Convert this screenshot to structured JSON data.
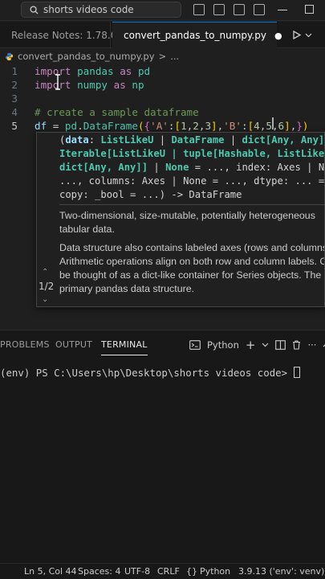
{
  "titlebar": {
    "search_text": "shorts videos code"
  },
  "tabs": [
    {
      "label": "Release Notes: 1.78.0",
      "active": false
    },
    {
      "label": "convert_pandas_to_numpy.py",
      "active": true,
      "modified_indicator": "●"
    }
  ],
  "breadcrumb": {
    "file": "convert_pandas_to_numpy.py",
    "separator": ">",
    "more": "..."
  },
  "editor": {
    "lines": [
      {
        "number": "1",
        "tokens": [
          [
            "kw",
            "import"
          ],
          [
            "op",
            " "
          ],
          [
            "mod",
            "pandas"
          ],
          [
            "op",
            " "
          ],
          [
            "kw",
            "as"
          ],
          [
            "op",
            " "
          ],
          [
            "mod",
            "pd"
          ]
        ]
      },
      {
        "number": "2",
        "tokens": [
          [
            "kw",
            "import"
          ],
          [
            "op",
            " "
          ],
          [
            "mod",
            "numpy"
          ],
          [
            "op",
            " "
          ],
          [
            "kw",
            "as"
          ],
          [
            "op",
            " "
          ],
          [
            "mod",
            "np"
          ]
        ]
      },
      {
        "number": "3",
        "tokens": []
      },
      {
        "number": "4",
        "tokens": [
          [
            "cm",
            "# create a sample dataframe"
          ]
        ]
      },
      {
        "number": "5",
        "tokens": [
          [
            "var",
            "df"
          ],
          [
            "op",
            " = "
          ],
          [
            "mod",
            "pd"
          ],
          [
            "op",
            "."
          ],
          [
            "mod",
            "DataFrame"
          ],
          [
            "br1",
            "("
          ],
          [
            "br2",
            "{"
          ],
          [
            "str",
            "'A'"
          ],
          [
            "op",
            ":"
          ],
          [
            "br1",
            "["
          ],
          [
            "num",
            "1"
          ],
          [
            "op",
            ","
          ],
          [
            "num",
            "2"
          ],
          [
            "op",
            ","
          ],
          [
            "num",
            "3"
          ],
          [
            "br1",
            "]"
          ],
          [
            "op",
            ","
          ],
          [
            "str",
            "'B'"
          ],
          [
            "op",
            ":"
          ],
          [
            "br1",
            "["
          ],
          [
            "num",
            "4"
          ],
          [
            "op",
            ","
          ],
          [
            "num",
            "5"
          ],
          [
            "op",
            ","
          ],
          [
            "num",
            "6"
          ],
          [
            "br1",
            "]"
          ],
          [
            "op",
            ","
          ],
          [
            "br2",
            "}"
          ],
          [
            "br1",
            ")"
          ]
        ]
      }
    ]
  },
  "signature_help": {
    "code_lines": [
      [
        [
          "op",
          "("
        ],
        [
          "p",
          "data"
        ],
        [
          "op",
          ": "
        ],
        [
          "t",
          "ListLikeU"
        ],
        [
          "op",
          " | "
        ],
        [
          "t",
          "DataFrame"
        ],
        [
          "op",
          " | "
        ],
        [
          "t",
          "dict[Any, Any]"
        ],
        [
          "op",
          " |"
        ]
      ],
      [
        [
          "t",
          "Iterable[ListLikeU | tuple[Hashable, ListLikeU]"
        ],
        [
          "op",
          " |"
        ]
      ],
      [
        [
          "t",
          "dict[Any, Any]]"
        ],
        [
          "op",
          " | "
        ],
        [
          "t",
          "None"
        ],
        [
          "op",
          " = ..., index: Axes | None"
        ]
      ],
      [
        [
          "op",
          "..., columns: Axes | None = ..., dtype: ... = ..."
        ]
      ],
      [
        [
          "op",
          "copy: _bool = ...) -> DataFrame"
        ]
      ]
    ],
    "doc_1": [
      "Two-dimensional, size-mutable, potentially heterogeneous",
      "tabular data."
    ],
    "doc_2": [
      "Data structure also contains labeled axes (rows and columns).",
      "Arithmetic operations align on both row and column labels. Can",
      "be thought of as a dict-like container for Series objects. The",
      "primary pandas data structure."
    ],
    "counter": "1/2"
  },
  "panel": {
    "tabs": [
      "PROBLEMS",
      "OUTPUT",
      "TERMINAL"
    ],
    "active_tab": "TERMINAL",
    "terminal_profile": "Python",
    "terminal_prompt": "(env) PS C:\\Users\\hp\\Desktop\\shorts videos code> "
  },
  "statusbar": {
    "position": "Ln 5, Col 44",
    "spaces": "Spaces: 4",
    "encoding": "UTF-8",
    "eol": "CRLF",
    "language": "Python",
    "interpreter": "3.9.13 ('env': venv)"
  },
  "colors": {
    "accent": "#0078d4",
    "keyword": "#c586c0",
    "type": "#4ec9b0",
    "comment": "#6a9955"
  }
}
